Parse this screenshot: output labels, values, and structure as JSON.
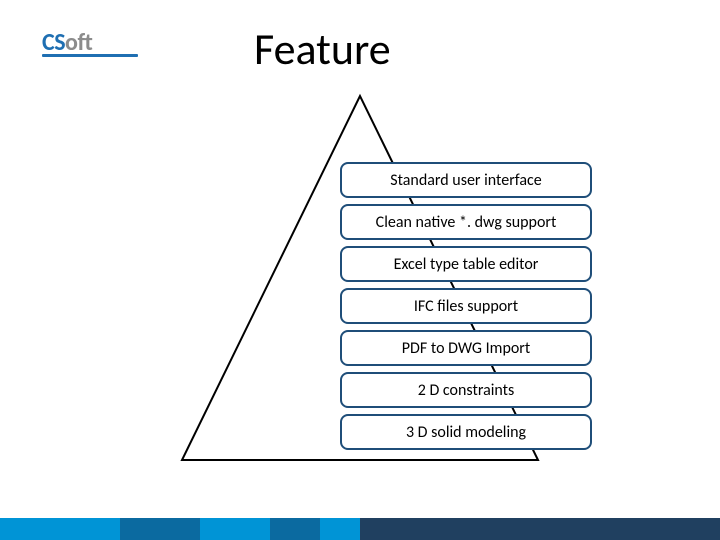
{
  "logo": {
    "part1": "CS",
    "part2": "oft"
  },
  "title": "Feature",
  "features": {
    "items": [
      "Standard user interface",
      "Clean native *. dwg support",
      "Excel type table editor",
      "IFC files support",
      "PDF to DWG Import",
      "2 D constraints",
      "3 D solid modeling"
    ]
  },
  "colors": {
    "brand_blue": "#1f6fb2",
    "pill_border": "#1f4e79",
    "footer_light": "#0094d6",
    "footer_mid": "#0b6aa0",
    "footer_dark": "#204060"
  }
}
